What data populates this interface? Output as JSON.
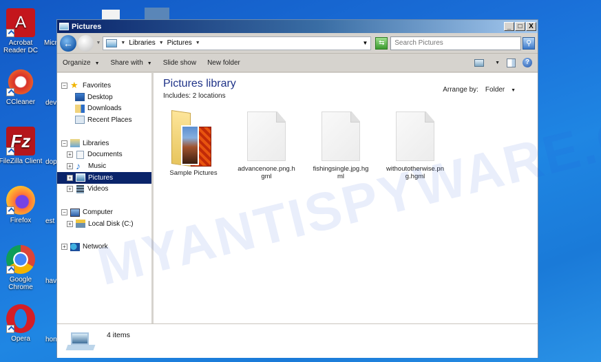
{
  "desktop": {
    "icons": [
      {
        "label": "Acrobat Reader DC",
        "icon": "acrobat-icon",
        "color": "#c4161c"
      },
      {
        "label": "CCleaner",
        "icon": "ccleaner-icon",
        "color": "#d8312a"
      },
      {
        "label": "FileZilla Client",
        "icon": "filezilla-icon",
        "color": "#b5161b"
      },
      {
        "label": "Firefox",
        "icon": "firefox-icon",
        "color": "#ff7139"
      },
      {
        "label": "Google Chrome",
        "icon": "chrome-icon",
        "color": "#4285f4"
      },
      {
        "label": "Opera",
        "icon": "opera-icon",
        "color": "#d41e26"
      }
    ],
    "partial_labels": [
      "Micr",
      "dev",
      "dop",
      "est",
      "hav",
      "hon"
    ]
  },
  "window": {
    "title": "Pictures",
    "controls": {
      "minimize": "_",
      "maximize": "□",
      "close": "X"
    },
    "address": {
      "breadcrumb": [
        "Libraries",
        "Pictures"
      ],
      "search_placeholder": "Search Pictures"
    },
    "toolbar": {
      "organize": "Organize",
      "share_with": "Share with",
      "slide_show": "Slide show",
      "new_folder": "New folder"
    },
    "nav_tree": {
      "favorites": {
        "label": "Favorites",
        "items": [
          "Desktop",
          "Downloads",
          "Recent Places"
        ]
      },
      "libraries": {
        "label": "Libraries",
        "items": [
          "Documents",
          "Music",
          "Pictures",
          "Videos"
        ],
        "selected": "Pictures"
      },
      "computer": {
        "label": "Computer",
        "items": [
          "Local Disk (C:)"
        ]
      },
      "network": {
        "label": "Network"
      }
    },
    "content": {
      "title": "Pictures library",
      "subtitle": "Includes:  2 locations",
      "arrange_label": "Arrange by:",
      "arrange_value": "Folder",
      "items": [
        {
          "name": "Sample Pictures",
          "type": "folder"
        },
        {
          "name": "advancenone.png.hgml",
          "type": "file"
        },
        {
          "name": "fishingsingle.jpg.hgml",
          "type": "file"
        },
        {
          "name": "withoutotherwise.png.hgml",
          "type": "file"
        }
      ]
    },
    "status": {
      "item_count": "4 items"
    }
  },
  "watermark": "MYANTISPYWARE.COM"
}
